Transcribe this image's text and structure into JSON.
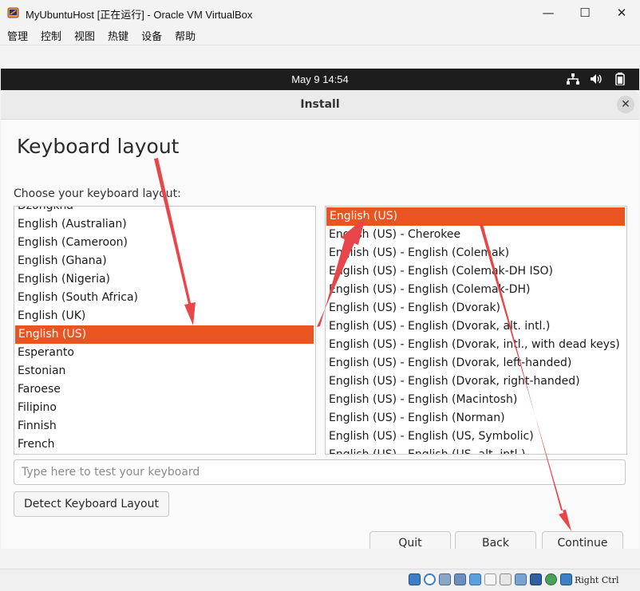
{
  "host_window": {
    "title": "MyUbuntuHost [正在运行] - Oracle VM VirtualBox",
    "minimize_glyph": "—",
    "maximize_glyph": "☐",
    "close_glyph": "✕",
    "app_icon": "virtualbox-icon"
  },
  "host_menu": [
    "管理",
    "控制",
    "视图",
    "热键",
    "设备",
    "帮助"
  ],
  "guest_topbar": {
    "clock": "May 9  14:54",
    "tray_icons": [
      "network-icon",
      "volume-icon",
      "battery-icon"
    ]
  },
  "installer": {
    "header_title": "Install",
    "close_glyph": "✕",
    "page_title": "Keyboard layout",
    "choose_label": "Choose your keyboard layout:",
    "layouts": [
      "Dzongkha",
      "English (Australian)",
      "English (Cameroon)",
      "English (Ghana)",
      "English (Nigeria)",
      "English (South Africa)",
      "English (UK)",
      "English (US)",
      "Esperanto",
      "Estonian",
      "Faroese",
      "Filipino",
      "Finnish",
      "French"
    ],
    "selected_layout": "English (US)",
    "variants": [
      "English (US)",
      "English (US) - Cherokee",
      "English (US) - English (Colemak)",
      "English (US) - English (Colemak-DH ISO)",
      "English (US) - English (Colemak-DH)",
      "English (US) - English (Dvorak)",
      "English (US) - English (Dvorak, alt. intl.)",
      "English (US) - English (Dvorak, intl., with dead keys)",
      "English (US) - English (Dvorak, left-handed)",
      "English (US) - English (Dvorak, right-handed)",
      "English (US) - English (Macintosh)",
      "English (US) - English (Norman)",
      "English (US) - English (US, Symbolic)",
      "English (US) - English (US, alt. intl.)"
    ],
    "selected_variant": "English (US)",
    "test_placeholder": "Type here to test your keyboard",
    "test_value": "",
    "detect_button": "Detect Keyboard Layout",
    "quit_button": "Quit",
    "back_button": "Back",
    "continue_button": "Continue"
  },
  "statusbar": {
    "icons": [
      "hard-disk-icon",
      "optical-drive-icon",
      "audio-icon",
      "network-adapter-icon",
      "usb-icon",
      "shared-folders-icon",
      "display-icon",
      "video-capture-icon",
      "vt-x-icon",
      "mouse-integration-icon",
      "keyboard-icon"
    ],
    "host_key_label": "Right Ctrl"
  },
  "annotation_color": "#e8464a",
  "accent_color": "#e95420"
}
